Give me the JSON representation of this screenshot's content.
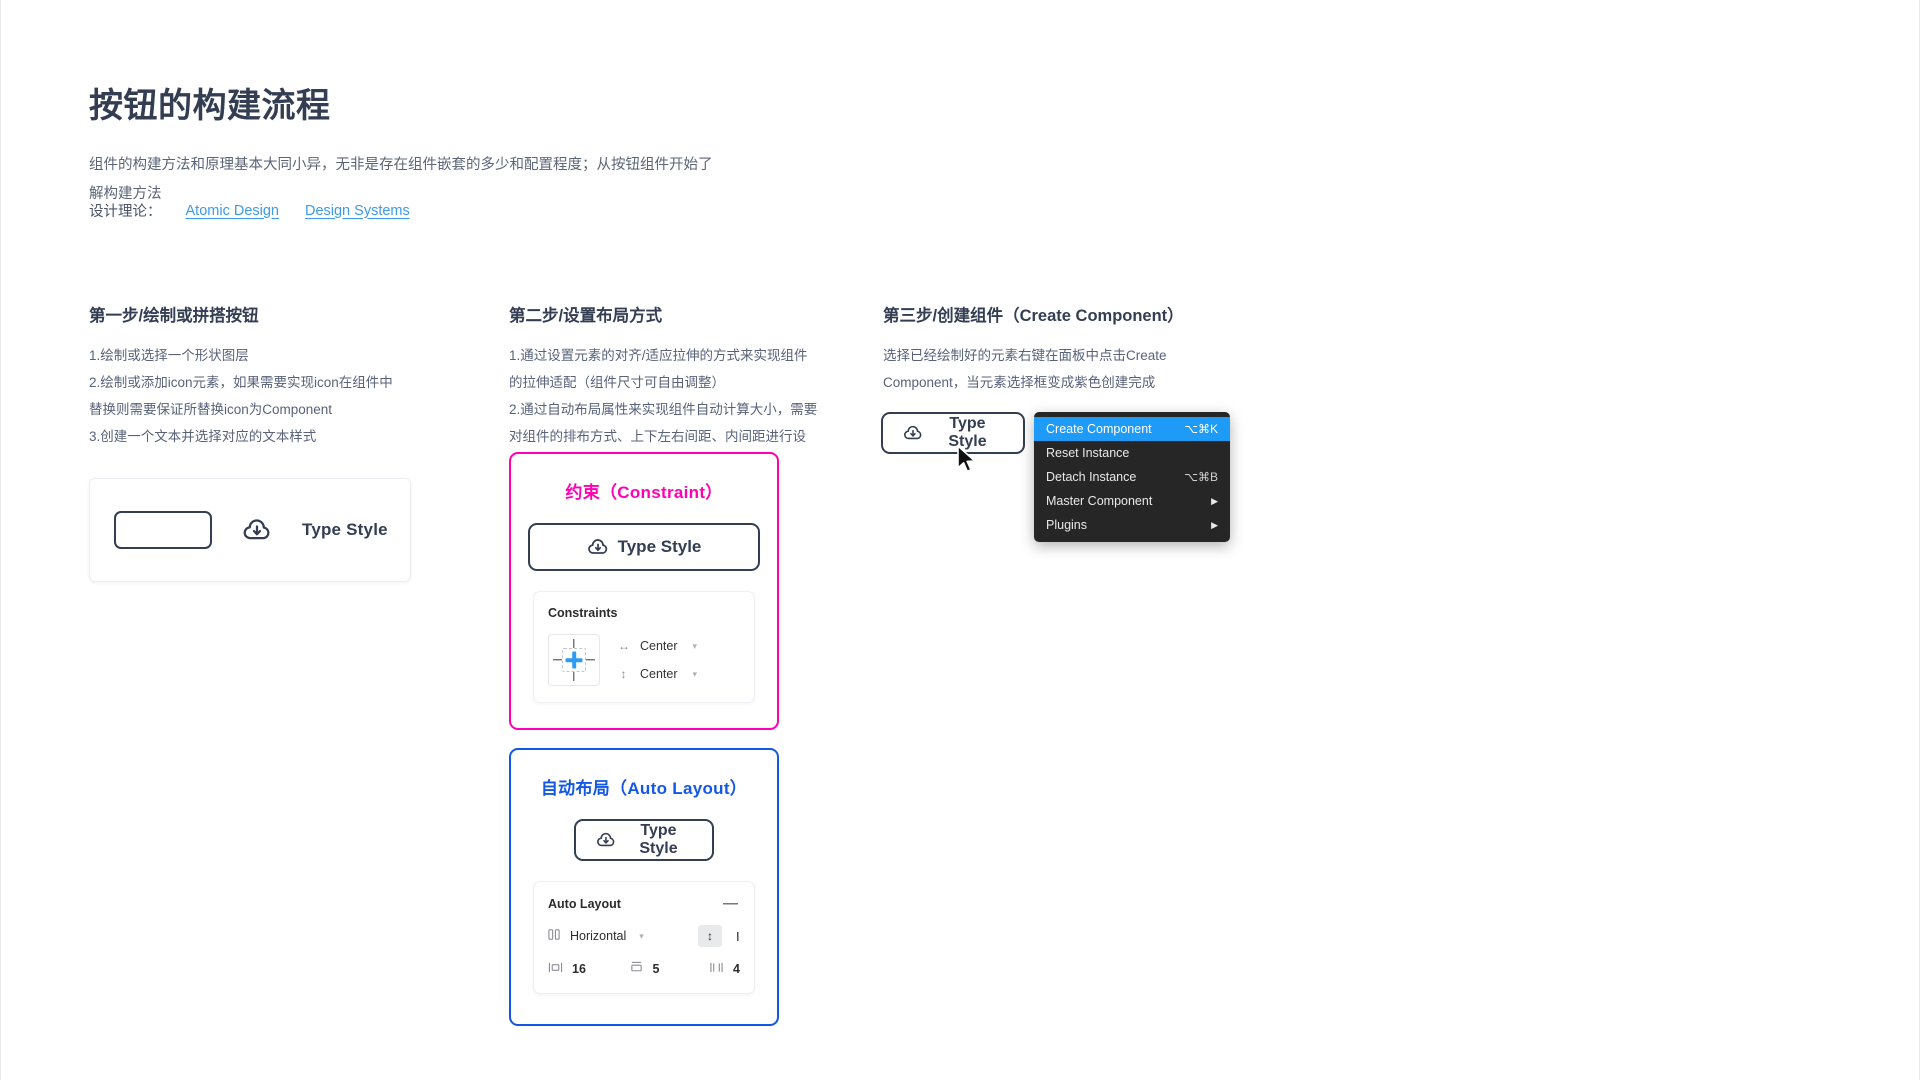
{
  "header": {
    "title": "按钮的构建流程",
    "description": "组件的构建方法和原理基本大同小异，无非是存在组件嵌套的多少和配置程度；从按钮组件开始了\n解构建方法",
    "theory_label": "设计理论：",
    "links": [
      {
        "label": "Atomic Design"
      },
      {
        "label": "Design Systems"
      }
    ]
  },
  "columns": {
    "step1": {
      "title": "第一步/绘制或拼搭按钮",
      "body": "1.绘制或选择一个形状图层\n2.绘制或添加icon元素，如果需要实现icon在组件中\n替换则需要保证所替换icon为Component\n3.创建一个文本并选择对应的文本样式",
      "type_style_label": "Type Style"
    },
    "step2": {
      "title": "第二步/设置布局方式",
      "body": "1.通过设置元素的对齐/适应拉伸的方式来实现组件\n的拉伸适配（组件尺寸可自由调整）\n2.通过自动布局属性来实现组件自动计算大小，需要\n对组件的排布方式、上下左右间距、内间距进行设\n置（组件尺寸通过间距调整）"
    },
    "step3": {
      "title": "第三步/创建组件（Create Component）",
      "body": "选择已经绘制好的元素右键在面板中点击Create\nComponent，当元素选择框变成紫色创建完成",
      "button_label": "Type Style"
    }
  },
  "constraint_card": {
    "title": "约束（Constraint）",
    "accent": "#ff00b3",
    "button_label": "Type Style",
    "panel_title": "Constraints",
    "fields": [
      {
        "icon": "horizontal-arrows-icon",
        "glyph": "↔",
        "value": "Center"
      },
      {
        "icon": "vertical-arrows-icon",
        "glyph": "↕",
        "value": "Center"
      }
    ]
  },
  "autolayout_card": {
    "title": "自动布局（Auto Layout）",
    "accent": "#1257e5",
    "button_label": "Type Style",
    "panel_title": "Auto Layout",
    "collapse_glyph": "—",
    "direction": {
      "icon": "columns-icon",
      "value": "Horizontal"
    },
    "resize_toggle_glyph": "↕",
    "text_resize_glyph": "I",
    "spacing": [
      {
        "icon": "spacing-between-icon",
        "value": "16"
      },
      {
        "icon": "padding-vertical-icon",
        "value": "5"
      },
      {
        "icon": "padding-horizontal-icon",
        "value": "4"
      }
    ]
  },
  "context_menu": {
    "items": [
      {
        "label": "Create Component",
        "shortcut": "⌥⌘K",
        "active": true,
        "submenu": false
      },
      {
        "label": "Reset Instance",
        "shortcut": "",
        "active": false,
        "submenu": false
      },
      {
        "label": "Detach Instance",
        "shortcut": "⌥⌘B",
        "active": false,
        "submenu": false
      },
      {
        "label": "Master Component",
        "shortcut": "",
        "active": false,
        "submenu": true
      },
      {
        "label": "Plugins",
        "shortcut": "",
        "active": false,
        "submenu": true
      }
    ],
    "highlight_color": "#1e9bf7",
    "background_color": "#262626"
  }
}
